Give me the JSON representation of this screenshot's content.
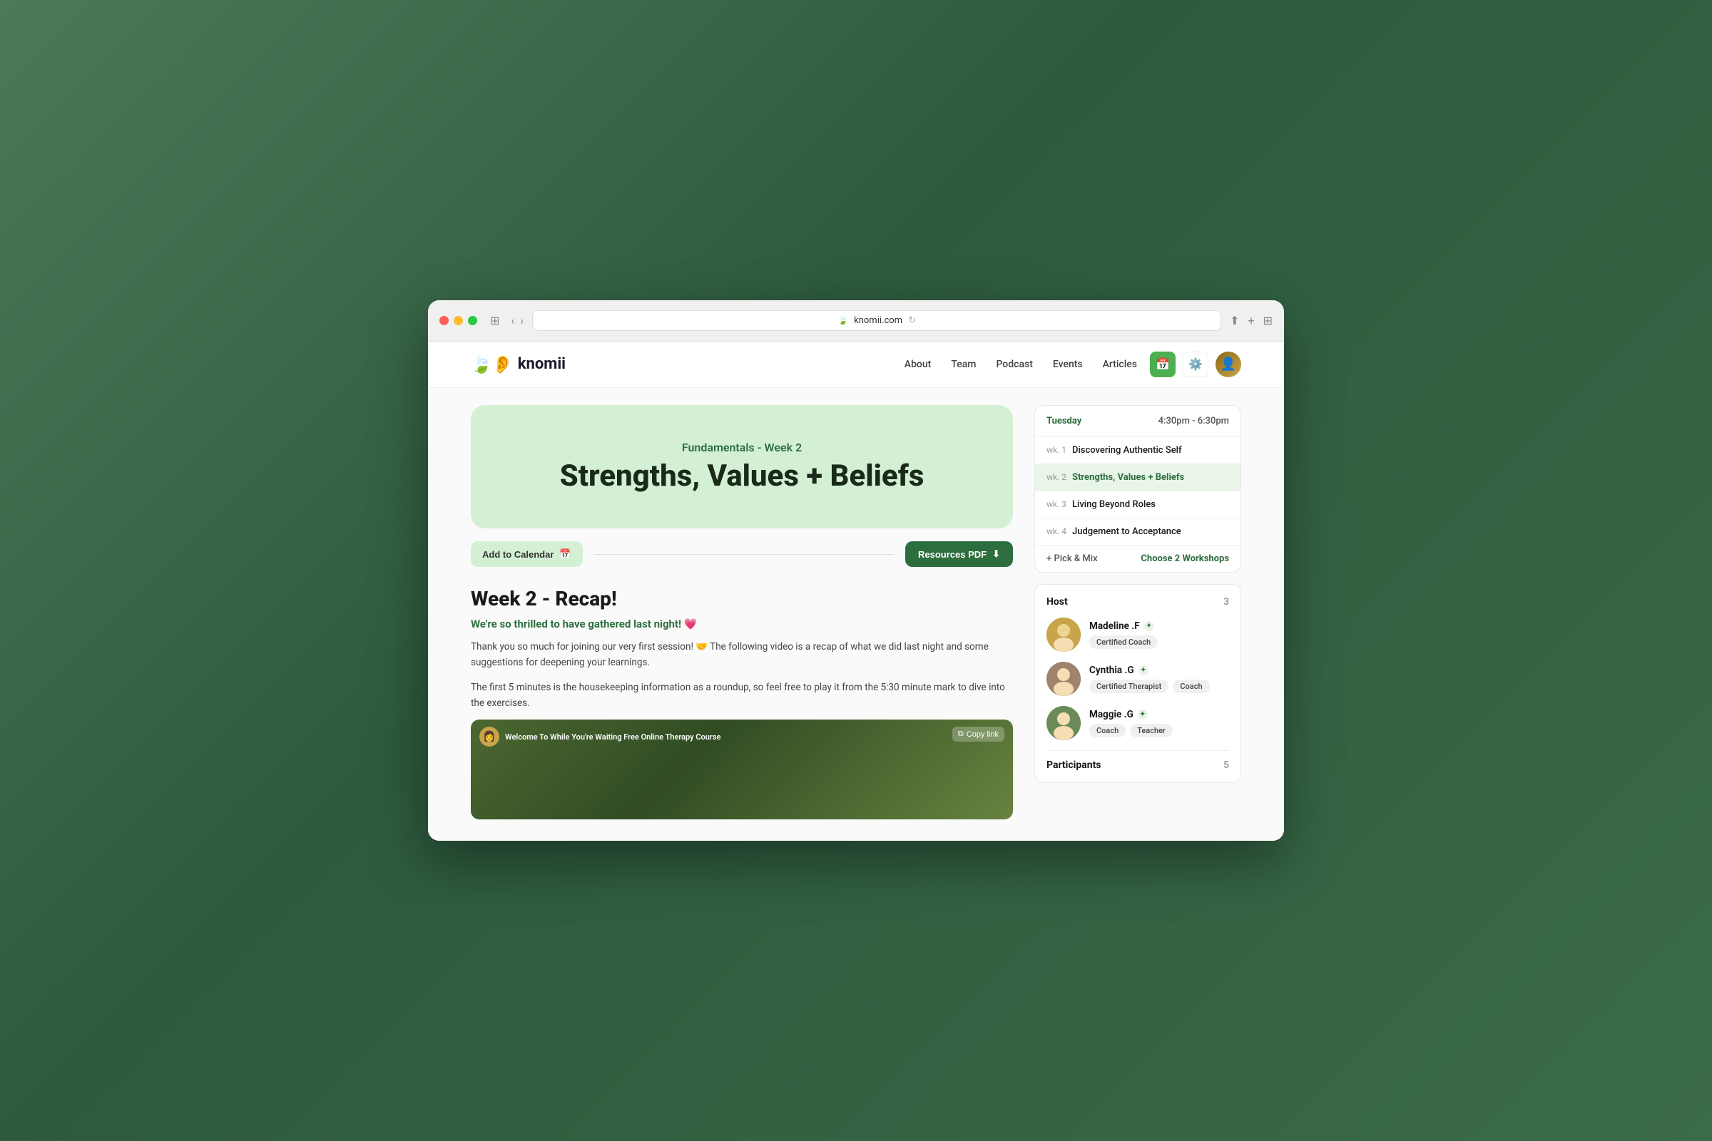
{
  "browser": {
    "url": "knomii.com",
    "favicon": "🍃"
  },
  "nav": {
    "logo_text": "knomii",
    "logo_emoji": "🍃 👂",
    "links": [
      "About",
      "Team",
      "Podcast",
      "Events",
      "Articles"
    ],
    "calendar_icon": "📅",
    "settings_icon": "⚙️"
  },
  "hero": {
    "subtitle": "Fundamentals - Week 2",
    "title": "Strengths, Values + Beliefs"
  },
  "actions": {
    "add_calendar": "Add to Calendar",
    "resources_pdf": "Resources PDF"
  },
  "schedule": {
    "day": "Tuesday",
    "time": "4:30pm - 6:30pm",
    "weeks": [
      {
        "wk": "wk. 1",
        "title": "Discovering Authentic Self",
        "active": false
      },
      {
        "wk": "wk. 2",
        "title": "Strengths, Values + Beliefs",
        "active": true
      },
      {
        "wk": "wk. 3",
        "title": "Living Beyond Roles",
        "active": false
      },
      {
        "wk": "wk. 4",
        "title": "Judgement to Acceptance",
        "active": false
      }
    ],
    "pick_mix": "+ Pick & Mix",
    "choose_workshops": "Choose 2 Workshops"
  },
  "recap": {
    "title": "Week 2 - Recap!",
    "highlight": "We're so thrilled to have gathered last night! 💗",
    "text1": "Thank you so much for joining our very first session! 🤝 The following video is a recap of what we did last night and some suggestions for deepening your learnings.",
    "text2": "The first 5 minutes is the housekeeping information as a roundup, so feel free to play it from the 5:30 minute mark to dive into the exercises.",
    "video_title": "Welcome To While You're Waiting Free Online Therapy Course",
    "copy_link": "Copy link"
  },
  "hosts": {
    "title": "Host",
    "count": "3",
    "items": [
      {
        "name": "Madeline .F",
        "emoji": "👩",
        "tags": [
          "Certified Coach"
        ],
        "avatar_bg": "madeline"
      },
      {
        "name": "Cynthia .G",
        "emoji": "👩",
        "tags": [
          "Certified Therapist",
          "Coach"
        ],
        "avatar_bg": "cynthia"
      },
      {
        "name": "Maggie .G",
        "emoji": "👩",
        "tags": [
          "Coach",
          "Teacher"
        ],
        "avatar_bg": "maggie"
      }
    ]
  },
  "participants": {
    "label": "Participants",
    "count": "5"
  }
}
